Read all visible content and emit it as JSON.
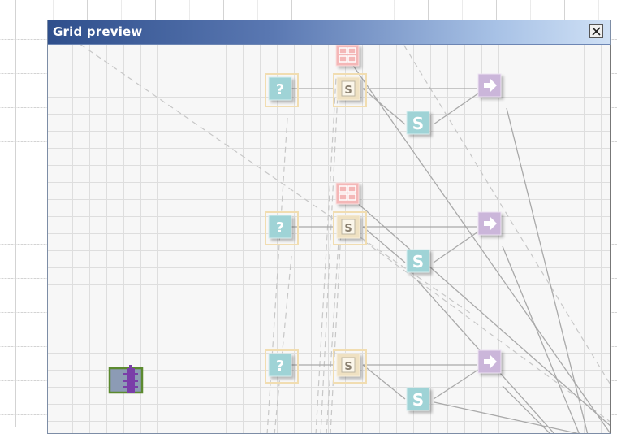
{
  "window": {
    "title": "Grid preview",
    "close_icon": "close-icon"
  },
  "canvas": {
    "description_free": true,
    "rows": [
      {
        "nodes": [
          "table-icon",
          "question-icon",
          "script-icon",
          "s-icon",
          "arrow-right-icon"
        ]
      },
      {
        "nodes": [
          "table-icon",
          "question-icon",
          "script-icon",
          "s-icon",
          "arrow-right-icon"
        ]
      },
      {
        "nodes": [
          "question-icon",
          "script-icon",
          "s-icon",
          "arrow-right-icon"
        ]
      }
    ],
    "selected_node": "purple-component-icon",
    "glyphs": {
      "question": "?",
      "script": "S",
      "s": "S",
      "arrow": "➜"
    },
    "colors": {
      "titlebar_start": "#2f4f8c",
      "titlebar_end": "#cfe0f5",
      "teal_node": "#9fd3d6",
      "script_node": "#efe1c2",
      "table_node": "#f4b7b7",
      "arrow_node": "#cbb6da",
      "selected_border": "#5c8a2f",
      "selected_fill": "#8c9bb5",
      "purple": "#7a3ea8"
    }
  }
}
